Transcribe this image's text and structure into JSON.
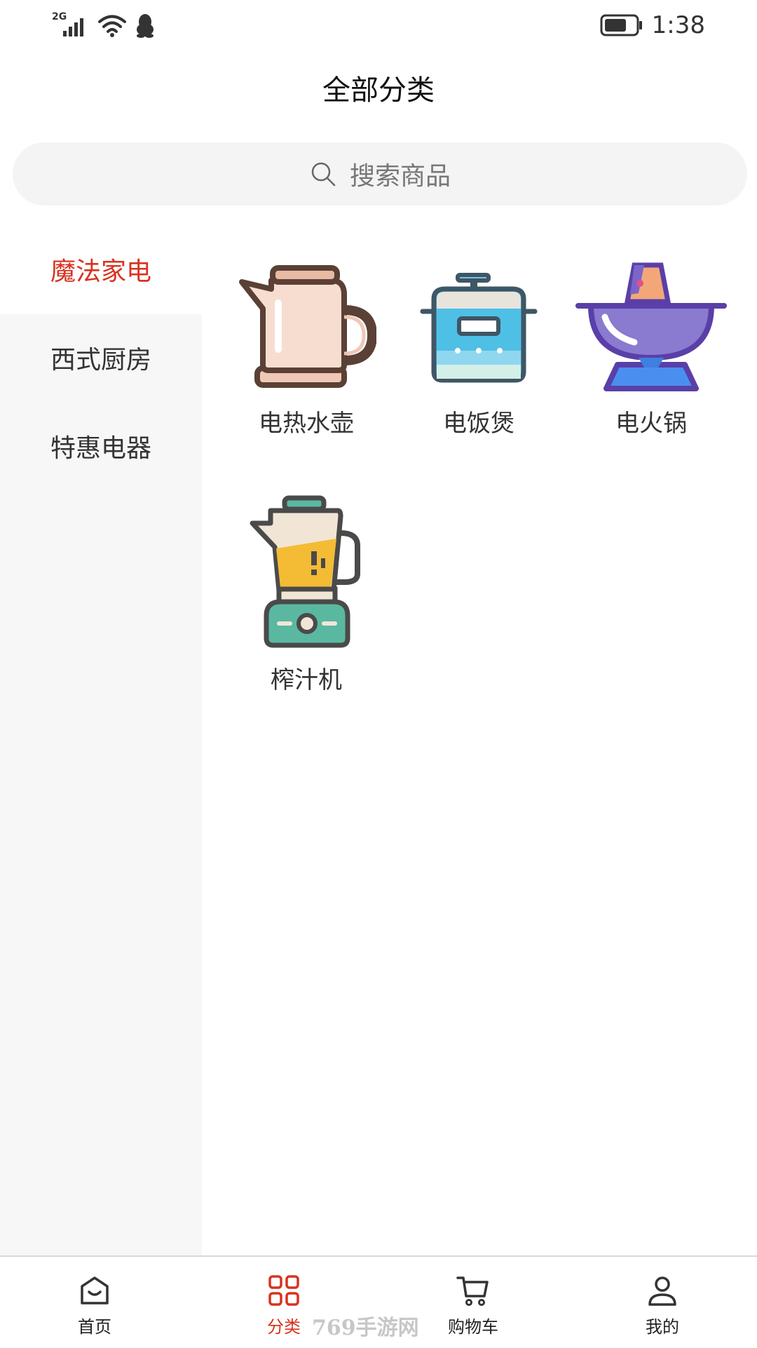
{
  "statusbar": {
    "network": "2G",
    "time": "1:38",
    "icons": [
      "signal-icon",
      "wifi-icon",
      "qq-icon",
      "battery-icon"
    ]
  },
  "header": {
    "title": "全部分类"
  },
  "search": {
    "placeholder": "搜索商品"
  },
  "sidebar": {
    "items": [
      {
        "label": "魔法家电",
        "active": true
      },
      {
        "label": "西式厨房",
        "active": false
      },
      {
        "label": "特惠电器",
        "active": false
      }
    ]
  },
  "categories": {
    "items": [
      {
        "label": "电热水壶",
        "icon": "kettle-icon"
      },
      {
        "label": "电饭煲",
        "icon": "rice-cooker-icon"
      },
      {
        "label": "电火锅",
        "icon": "hotpot-icon"
      },
      {
        "label": "榨汁机",
        "icon": "juicer-icon"
      }
    ]
  },
  "tabbar": {
    "items": [
      {
        "label": "首页",
        "icon": "home-icon",
        "active": false
      },
      {
        "label": "分类",
        "icon": "category-grid-icon",
        "active": true
      },
      {
        "label": "购物车",
        "icon": "cart-icon",
        "active": false
      },
      {
        "label": "我的",
        "icon": "user-icon",
        "active": false
      }
    ]
  },
  "watermark": {
    "text": "769手游网"
  },
  "colors": {
    "accent": "#d8321f",
    "sidebar_bg": "#f7f7f7",
    "search_bg": "#f4f4f4"
  }
}
